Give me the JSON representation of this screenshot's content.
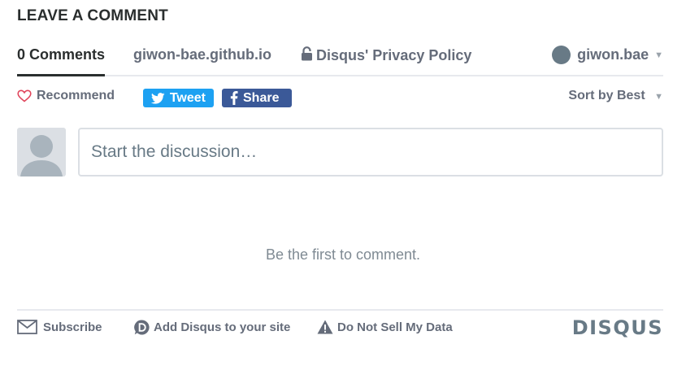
{
  "section": {
    "heading": "LEAVE A COMMENT"
  },
  "nav": {
    "comments_tab": "0 Comments",
    "site_link": "giwon-bae.github.io",
    "privacy_link": "Disqus' Privacy Policy",
    "user_name": "giwon.bae",
    "icons": {
      "lock": "lock-icon",
      "user_avatar": "user-avatar",
      "caret": "chevron-down-icon"
    }
  },
  "toolbar": {
    "recommend_label": "Recommend",
    "tweet_label": "Tweet",
    "share_label": "Share",
    "sort_label": "Sort by Best",
    "colors": {
      "tweet": "#1da1f2",
      "share": "#3b5998",
      "heart": "#e0445b"
    }
  },
  "compose": {
    "placeholder": "Start the discussion…"
  },
  "empty_state": {
    "message": "Be the first to comment."
  },
  "footer": {
    "subscribe_label": "Subscribe",
    "add_disqus_label": "Add Disqus to your site",
    "do_not_sell_label": "Do Not Sell My Data",
    "logo_text": "DISQUS"
  }
}
